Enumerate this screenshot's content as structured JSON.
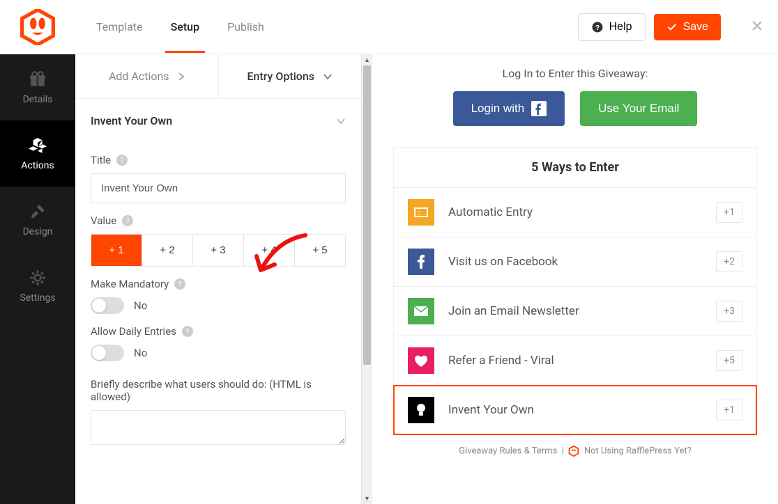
{
  "topbar": {
    "tabs": {
      "template": "Template",
      "setup": "Setup",
      "publish": "Publish"
    },
    "help": "Help",
    "save": "Save"
  },
  "sidebar": {
    "details": "Details",
    "actions": "Actions",
    "design": "Design",
    "settings": "Settings"
  },
  "panel": {
    "add_actions": "Add Actions",
    "entry_options": "Entry Options",
    "section_title": "Invent Your Own",
    "title_label": "Title",
    "title_value": "Invent Your Own",
    "value_label": "Value",
    "values": [
      "+ 1",
      "+ 2",
      "+ 3",
      "+ 4",
      "+ 5"
    ],
    "mandatory_label": "Make Mandatory",
    "mandatory_value": "No",
    "daily_label": "Allow Daily Entries",
    "daily_value": "No",
    "describe_label": "Briefly describe what users should do: (HTML is allowed)"
  },
  "preview": {
    "login_prompt": "Log In to Enter this Giveaway:",
    "login_fb": "Login with",
    "use_email": "Use Your Email",
    "ways_title": "5 Ways to Enter",
    "entries": [
      {
        "label": "Automatic Entry",
        "points": "+1",
        "bg": "#f5a623"
      },
      {
        "label": "Visit us on Facebook",
        "points": "+2",
        "bg": "#3b5998"
      },
      {
        "label": "Join an Email Newsletter",
        "points": "+3",
        "bg": "#4caf50"
      },
      {
        "label": "Refer a Friend - Viral",
        "points": "+5",
        "bg": "#e91e63"
      },
      {
        "label": "Invent Your Own",
        "points": "+1",
        "bg": "#000000"
      }
    ],
    "footer_rules": "Giveaway Rules & Terms",
    "footer_not_using": "Not Using RafflePress Yet?"
  }
}
